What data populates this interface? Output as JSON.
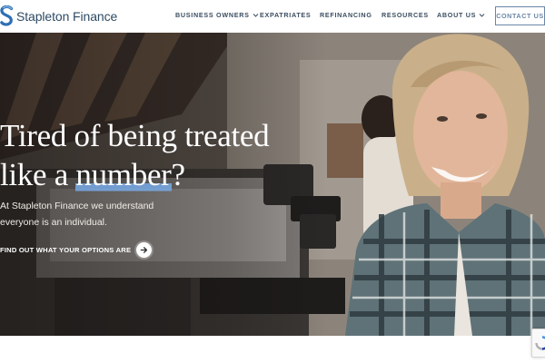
{
  "brand": {
    "name": "Stapleton Finance",
    "logo_icon": "stapleton-s-logo-icon",
    "primary_color": "#2e4a63",
    "accent_color": "#4a8fd6"
  },
  "nav": {
    "items": [
      {
        "label": "BUSINESS OWNERS",
        "has_dropdown": true
      },
      {
        "label": "EXPATRIATES",
        "has_dropdown": false
      },
      {
        "label": "REFINANCING",
        "has_dropdown": false
      },
      {
        "label": "RESOURCES",
        "has_dropdown": false
      },
      {
        "label": "ABOUT US",
        "has_dropdown": true
      }
    ],
    "contact_label": "CONTACT US"
  },
  "hero": {
    "headline_line1": "Tired of being treated",
    "headline_line2_prefix": "like a ",
    "headline_highlight": "number",
    "headline_suffix": "?",
    "subtext_line1": "At Stapleton Finance we understand",
    "subtext_line2": "everyone is an individual.",
    "cta_label": "FIND OUT WHAT YOUR OPTIONS ARE",
    "cta_icon": "arrow-right-icon",
    "image_subject": "smiling woman in plaid shirt in a cafe with espresso machine"
  },
  "widgets": {
    "recaptcha_icon": "recaptcha-icon"
  }
}
